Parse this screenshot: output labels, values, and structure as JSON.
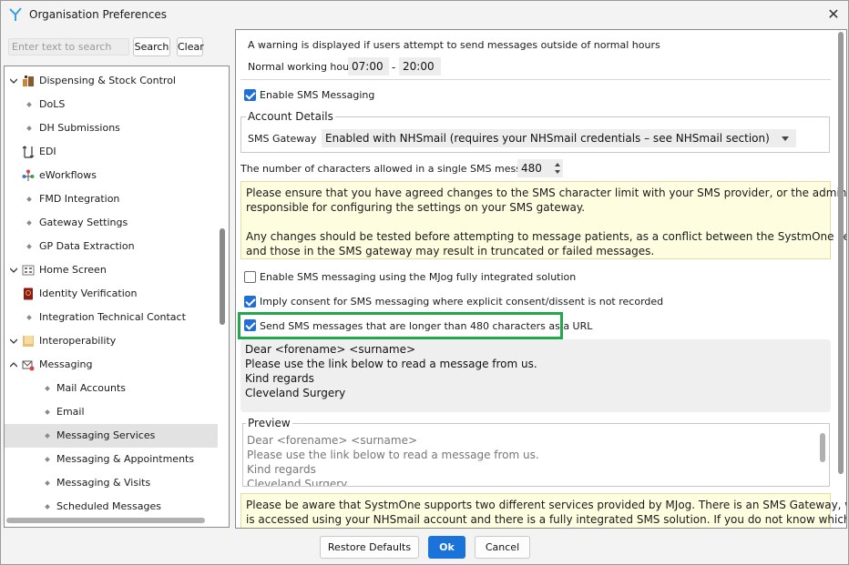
{
  "window": {
    "title": "Organisation Preferences",
    "close_glyph": "✕"
  },
  "search": {
    "placeholder": "Enter text to search",
    "search_label": "Search",
    "clear_label": "Clear"
  },
  "tree": {
    "items": [
      {
        "label": "Dispensing & Stock Control",
        "icon": "dispensing-icon",
        "expander": "expanded"
      },
      {
        "label": "DoLS",
        "icon": "bullet-icon"
      },
      {
        "label": "DH Submissions",
        "icon": "bullet-icon"
      },
      {
        "label": "EDI",
        "icon": "edi-icon"
      },
      {
        "label": "eWorkflows",
        "icon": "workflow-icon"
      },
      {
        "label": "FMD Integration",
        "icon": "bullet-icon"
      },
      {
        "label": "Gateway Settings",
        "icon": "bullet-icon"
      },
      {
        "label": "GP Data Extraction",
        "icon": "bullet-icon"
      },
      {
        "label": "Home Screen",
        "icon": "home-screen-icon",
        "expander": "expanded"
      },
      {
        "label": "Identity Verification",
        "icon": "passport-icon"
      },
      {
        "label": "Integration Technical Contact",
        "icon": "bullet-icon"
      },
      {
        "label": "Interoperability",
        "icon": "folder-icon",
        "expander": "expanded"
      },
      {
        "label": "Messaging",
        "icon": "messaging-icon",
        "expander": "collapsed-up"
      },
      {
        "label": "Mail Accounts",
        "icon": "bullet-icon"
      },
      {
        "label": "Email",
        "icon": "bullet-icon"
      },
      {
        "label": "Messaging Services",
        "icon": "bullet-icon",
        "selected": true
      },
      {
        "label": "Messaging & Appointments",
        "icon": "bullet-icon"
      },
      {
        "label": "Messaging & Visits",
        "icon": "bullet-icon"
      },
      {
        "label": "Scheduled Messages",
        "icon": "bullet-icon"
      }
    ]
  },
  "settings": {
    "hours_warning": "A warning is displayed if users attempt to send messages outside of normal hours",
    "working_hours_label": "Normal working hours",
    "start_time": "07:00",
    "time_separator": "-",
    "end_time": "20:00",
    "enable_sms_label": "Enable SMS Messaging",
    "enable_sms_checked": true,
    "account_details_legend": "Account Details",
    "sms_gateway_label": "SMS Gateway",
    "sms_gateway_value": "Enabled with NHSmail (requires your NHSmail credentials – see NHSmail section)",
    "char_limit_label": "The number of characters allowed in a single SMS message is",
    "char_limit_value": "480",
    "char_limit_note_1a": "Please ensure that you have agreed changes to the SMS character limit with your SMS provider, or the administrators",
    "char_limit_note_1b": "responsible for configuring the settings on your SMS gateway.",
    "char_limit_note_2a": "Any changes should be tested before attempting to message patients, as a conflict between the SystmOne settings",
    "char_limit_note_2b": "and those in the SMS gateway may result in truncated or failed messages.",
    "mjog_label": "Enable SMS messaging using the MJog fully integrated solution",
    "mjog_checked": false,
    "imply_consent_label": "Imply consent for SMS messaging where explicit consent/dissent is not recorded",
    "imply_consent_checked": true,
    "long_url_label": "Send SMS messages that are longer than 480 characters as a URL",
    "long_url_checked": true,
    "template_lines": [
      "Dear <forename> <surname>",
      "Please use the link below to read a message from us.",
      "Kind regards",
      "Cleveland Surgery"
    ],
    "preview_legend": "Preview",
    "preview_lines": [
      "Dear <forename> <surname>",
      "Please use the link below to read a message from us.",
      "Kind regards",
      "Cleveland Surgery"
    ],
    "mjog_note_a": "Please be aware that SystmOne supports two different services provided by MJog. There is an SMS Gateway, which",
    "mjog_note_b": "is accessed using your NHSmail account and there is a fully integrated SMS solution. If you do not know which of"
  },
  "footer": {
    "restore_label": "Restore Defaults",
    "ok_label": "Ok",
    "cancel_label": "Cancel"
  },
  "colors": {
    "accent": "#1a73d9",
    "highlight_border": "#22a84a",
    "note_background": "#fffde0"
  }
}
